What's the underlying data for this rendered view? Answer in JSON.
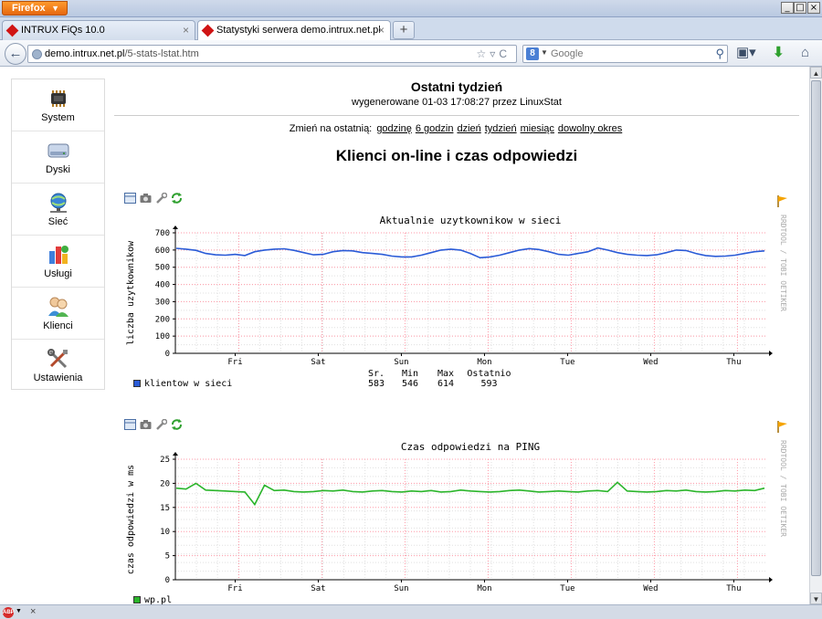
{
  "browser": {
    "menu_label": "Firefox",
    "tabs": [
      {
        "label": "INTRUX FiQs 10.0"
      },
      {
        "label": "Statystyki serwera demo.intrux.net.pl"
      }
    ],
    "url_host": "demo.intrux.net.pl",
    "url_path": "/5-stats-lstat.htm",
    "search_placeholder": "Google"
  },
  "sidebar": {
    "items": [
      {
        "label": "System",
        "icon": "chip-icon"
      },
      {
        "label": "Dyski",
        "icon": "disk-icon"
      },
      {
        "label": "Sieć",
        "icon": "network-globe-icon"
      },
      {
        "label": "Usługi",
        "icon": "services-icon"
      },
      {
        "label": "Klienci",
        "icon": "users-icon"
      },
      {
        "label": "Ustawienia",
        "icon": "tools-icon"
      }
    ]
  },
  "header": {
    "title": "Ostatni tydzień",
    "subtitle": "wygenerowane 01-03 17:08:27 przez LinuxStat"
  },
  "periods": {
    "prefix": "Zmień na ostatnią:",
    "links": [
      "godzinę",
      "6 godzin",
      "dzień",
      "tydzień",
      "miesiąc",
      "dowolny okres"
    ]
  },
  "section_title": "Klienci on-line i czas odpowiedzi",
  "rrd_side_text": "RRDTOOL / TOBI OETIKER",
  "colors": {
    "series1": "#2a5bd7",
    "series2": "#2bb52b",
    "grid_major": "#ff9aa8",
    "grid_minor": "#e0e0e0"
  },
  "chart_data": [
    {
      "type": "line",
      "title": "Aktualnie uzytkownikow w sieci",
      "ylabel": "liczba uzytkownikow",
      "xlabel": "",
      "x_ticks": [
        "Fri",
        "Sat",
        "Sun",
        "Mon",
        "Tue",
        "Wed",
        "Thu"
      ],
      "ylim": [
        0,
        700
      ],
      "y_ticks": [
        0,
        100,
        200,
        300,
        400,
        500,
        600,
        700
      ],
      "series": [
        {
          "name": "klientow w sieci",
          "values": [
            610,
            605,
            598,
            580,
            572,
            570,
            575,
            568,
            590,
            600,
            605,
            607,
            598,
            585,
            572,
            575,
            590,
            597,
            595,
            585,
            580,
            575,
            565,
            560,
            560,
            570,
            585,
            600,
            605,
            600,
            580,
            555,
            560,
            570,
            585,
            600,
            608,
            603,
            590,
            575,
            570,
            580,
            590,
            612,
            600,
            585,
            575,
            570,
            568,
            572,
            585,
            600,
            597,
            580,
            568,
            563,
            565,
            570,
            580,
            590,
            595
          ]
        }
      ],
      "stats": {
        "headers": [
          "Sr.",
          "Min",
          "Max",
          "Ostatnio"
        ],
        "values": [
          "583",
          "546",
          "614",
          "593"
        ]
      }
    },
    {
      "type": "line",
      "title": "Czas odpowiedzi na PING",
      "ylabel": "czas odpowiedzi w ms",
      "xlabel": "",
      "x_ticks": [
        "Fri",
        "Sat",
        "Sun",
        "Mon",
        "Tue",
        "Wed",
        "Thu"
      ],
      "ylim": [
        0,
        25
      ],
      "y_ticks": [
        0,
        5,
        10,
        15,
        20,
        25
      ],
      "series": [
        {
          "name": "wp.pl",
          "values": [
            19,
            18.8,
            20,
            18.6,
            18.5,
            18.4,
            18.3,
            18.2,
            15.6,
            19.6,
            18.5,
            18.6,
            18.3,
            18.2,
            18.3,
            18.5,
            18.4,
            18.6,
            18.3,
            18.2,
            18.4,
            18.5,
            18.3,
            18.2,
            18.4,
            18.3,
            18.5,
            18.2,
            18.3,
            18.6,
            18.4,
            18.3,
            18.2,
            18.3,
            18.5,
            18.6,
            18.4,
            18.2,
            18.3,
            18.4,
            18.3,
            18.2,
            18.4,
            18.5,
            18.3,
            20.2,
            18.4,
            18.3,
            18.2,
            18.3,
            18.5,
            18.4,
            18.6,
            18.3,
            18.2,
            18.3,
            18.5,
            18.4,
            18.6,
            18.5,
            19.0
          ]
        }
      ]
    }
  ]
}
